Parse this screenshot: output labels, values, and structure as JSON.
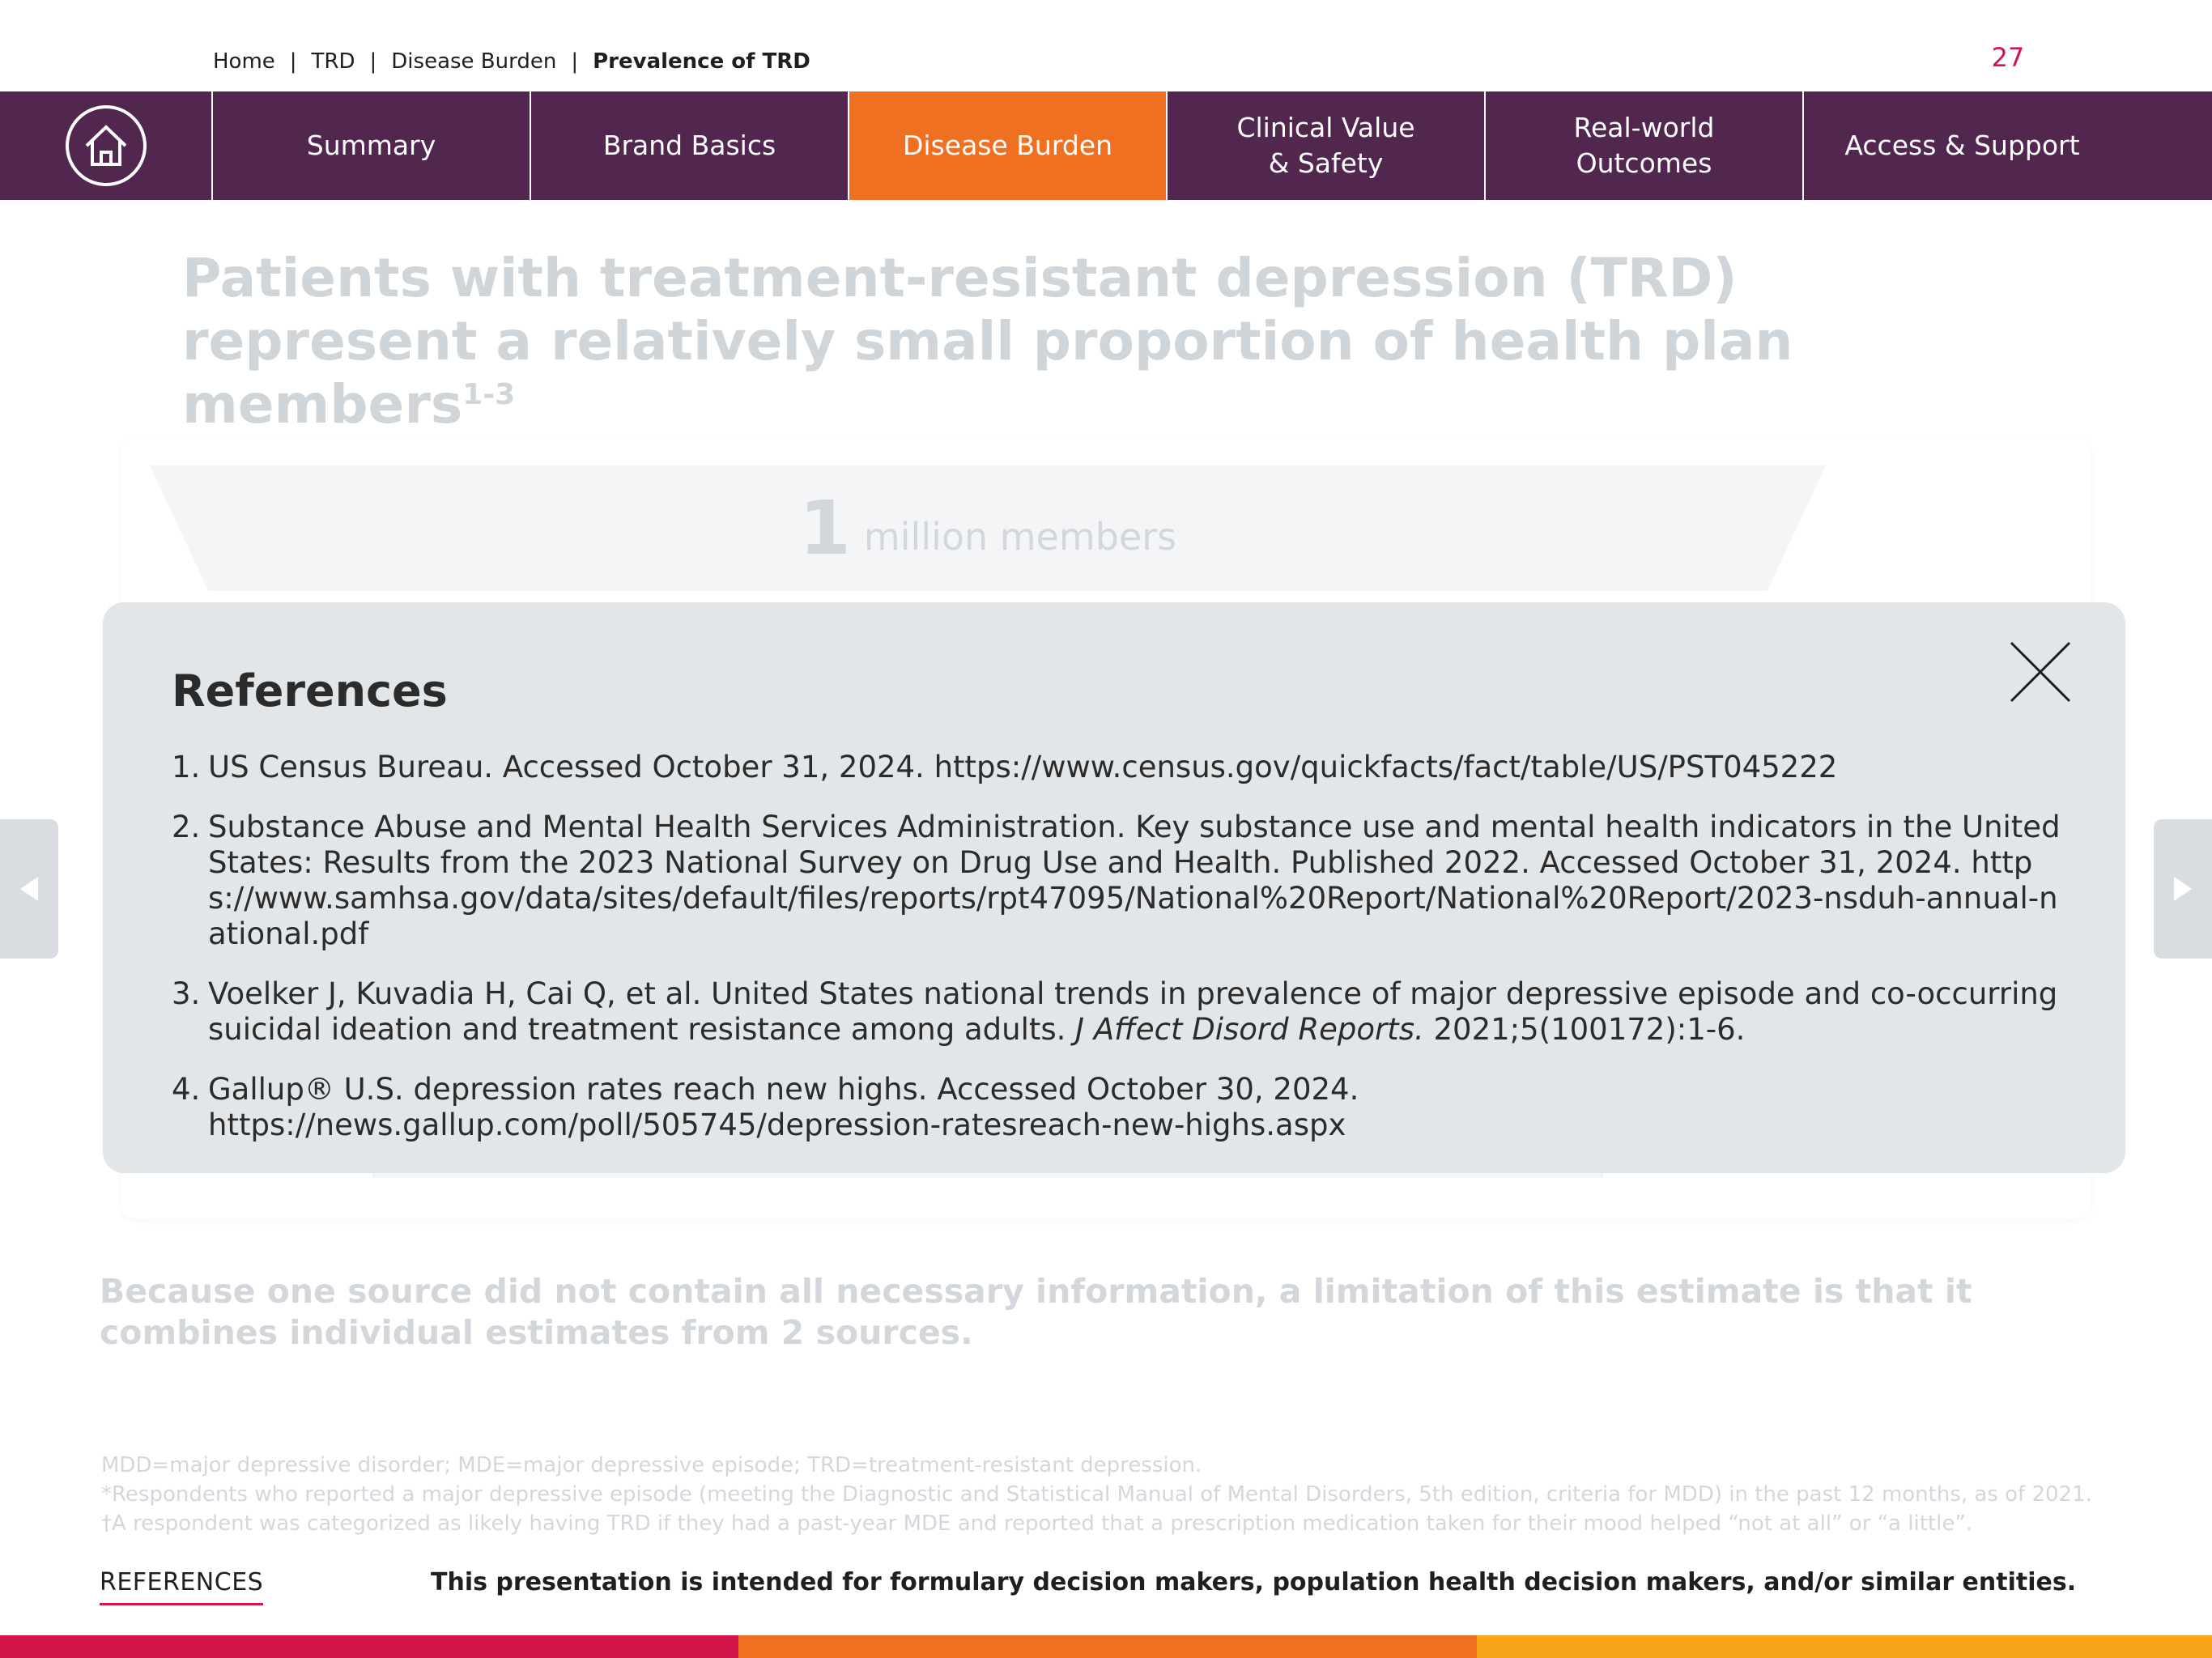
{
  "breadcrumb": {
    "items": [
      "Home",
      "TRD",
      "Disease Burden"
    ],
    "current": "Prevalence of TRD",
    "separator": "|"
  },
  "page_number": "27",
  "nav": {
    "home_icon": "home-icon",
    "items": [
      {
        "label": "Summary",
        "active": false
      },
      {
        "label": "Brand Basics",
        "active": false
      },
      {
        "label": "Disease Burden",
        "active": true
      },
      {
        "label": "Clinical Value\n& Safety",
        "active": false
      },
      {
        "label": "Real-world Outcomes",
        "active": false
      },
      {
        "label": "Access & Support",
        "active": false
      }
    ]
  },
  "headline": {
    "text": "Patients with treatment-resistant depression (TRD) represent a relatively small proportion of health plan members",
    "superscript": "1-3"
  },
  "funnel": {
    "top_number": "1",
    "top_label": "million members"
  },
  "limitation": "Because one source did not contain all necessary information, a limitation of this estimate is that it combines individual estimates from 2 sources.",
  "footnotes": [
    "MDD=major depressive disorder; MDE=major depressive episode; TRD=treatment-resistant depression.",
    "*Respondents who reported a major depressive episode (meeting the Diagnostic and Statistical Manual of Mental Disorders, 5th edition, criteria for MDD) in the past 12 months, as of 2021.",
    "†A respondent was categorized as likely having TRD if they had a past-year MDE and reported that a prescription medication taken for their mood helped “not at all” or “a little”."
  ],
  "modal": {
    "title": "References",
    "close_icon": "close-icon",
    "references": [
      {
        "num": "1.",
        "text": "US Census Bureau. Accessed October 31, 2024. https://www.census.gov/quickfacts/fact/table/US/PST045222"
      },
      {
        "num": "2.",
        "text": "Substance Abuse and Mental Health Services Administration. Key substance use and mental health indicators in the United States: Results from the 2023 National Survey on Drug Use and Health. Published 2022. Accessed October 31, 2024. https://www.samhsa.gov/data/sites/default/files/reports/rpt47095/National%20Report/National%20Report/2023-nsduh-annual-national.pdf"
      },
      {
        "num": "3.",
        "text_before": "Voelker J, Kuvadia H, Cai Q, et al. United States national trends in prevalence of major depressive episode and co-occurring suicidal ideation and treatment resistance among adults. ",
        "journal": "J Affect Disord Reports.",
        "text_after": " 2021;5(100172):1-6."
      },
      {
        "num": "4.",
        "text": "Gallup® U.S. depression rates reach new highs. Accessed October 30, 2024. https://news.gallup.com/poll/505745/depression-ratesreach-new-highs.aspx"
      }
    ]
  },
  "side_arrows": {
    "left_icon": "arrow-left-icon",
    "right_icon": "arrow-right-icon"
  },
  "footer": {
    "references_link": "REFERENCES",
    "disclaimer": "This presentation is intended for formulary decision makers, population health decision makers, and/or similar entities."
  },
  "colors": {
    "nav_background": "#51274f",
    "nav_active": "#f07022",
    "page_number": "#d3154b",
    "modal_background": "#e2e6e9",
    "bottom_bar": [
      "#d3154b",
      "#f07022",
      "#f9a51a"
    ]
  }
}
